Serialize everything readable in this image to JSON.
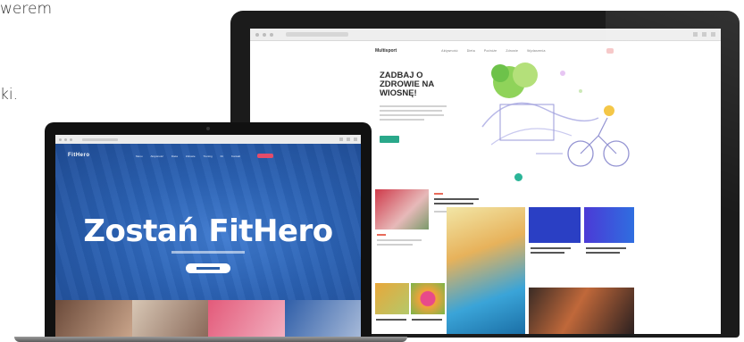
{
  "page_fragments": {
    "line1": "werem",
    "line2": "ki."
  },
  "monitor_site": {
    "logo": "Multisport",
    "nav_items": [
      "Aktywność",
      "Dieta",
      "Podróże",
      "Zdrowie",
      "Wydarzenia"
    ],
    "hero_title": "ZADBAJ O ZDROWIE NA WIOSNĘ!",
    "accent_color": "#2bb598"
  },
  "laptop_site": {
    "logo": "FitHero",
    "menu_items": [
      "Menu",
      "Aktywność",
      "Dieta",
      "Zdrowie",
      "Trening",
      "Fit",
      "Kontakt"
    ],
    "headline": "Zostań FitHero",
    "brand_color": "#2a5fa8"
  },
  "icons": [
    "heart-icon",
    "window-control-icon"
  ]
}
